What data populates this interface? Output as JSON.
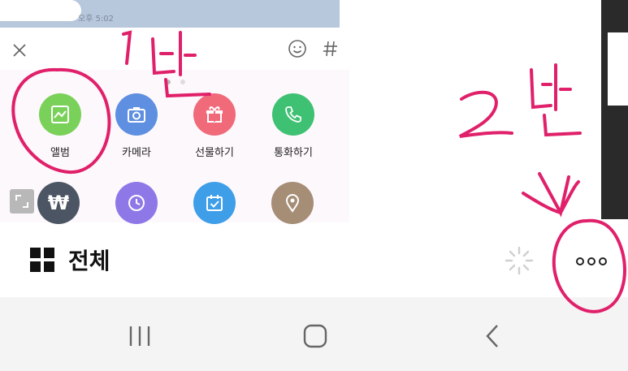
{
  "chat": {
    "time": "오후 5:02"
  },
  "panel": {
    "close_label": "close",
    "tiles_row1": [
      {
        "label": "앨범",
        "color": "#7ad15a",
        "icon": "image-icon"
      },
      {
        "label": "카메라",
        "color": "#5f8fe0",
        "icon": "camera-icon"
      },
      {
        "label": "선물하기",
        "color": "#f06a7a",
        "icon": "gift-icon"
      },
      {
        "label": "통화하기",
        "color": "#3fc173",
        "icon": "phone-icon"
      }
    ],
    "tiles_row2": [
      {
        "label": "",
        "color": "#4b5563",
        "icon": "won-icon",
        "glyph": "₩"
      },
      {
        "label": "",
        "color": "#8e78e8",
        "icon": "clock-icon"
      },
      {
        "label": "",
        "color": "#3e9ee8",
        "icon": "calendar-check-icon"
      },
      {
        "label": "",
        "color": "#a58d76",
        "icon": "location-pin-icon"
      }
    ]
  },
  "bottom": {
    "all_label": "전체"
  },
  "annotations": {
    "label1": "1번",
    "label2": "2번"
  },
  "colors": {
    "annotation": "#e0206a",
    "chat_bg": "#b7c7dc",
    "navbar_bg": "#f4f4f4"
  }
}
